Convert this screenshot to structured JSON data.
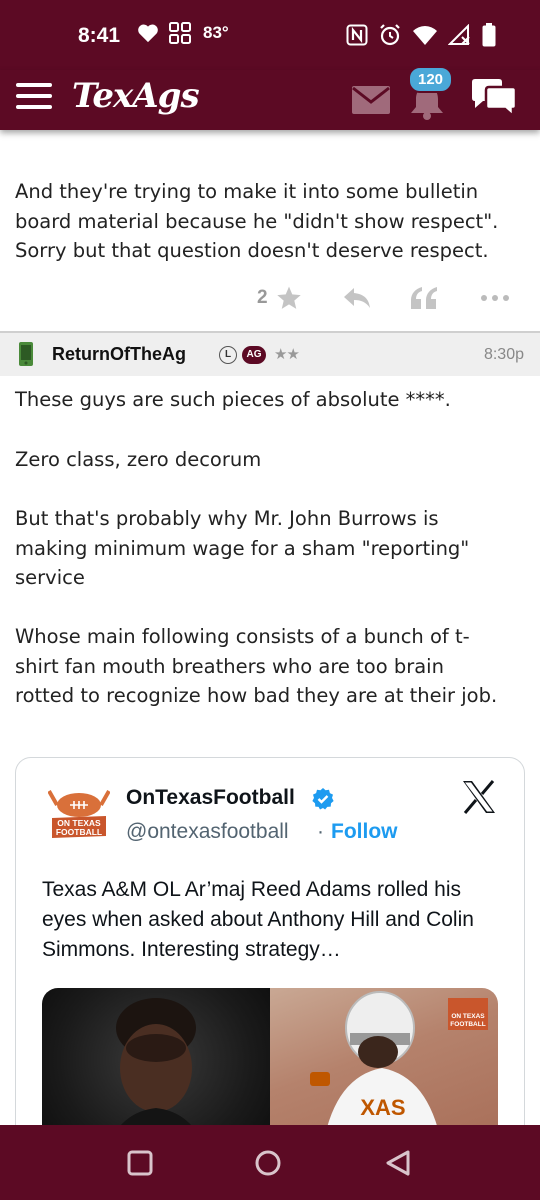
{
  "status_bar": {
    "time": "8:41",
    "temperature": "83°"
  },
  "app_bar": {
    "logo": "TexAgs",
    "notification_count": "120"
  },
  "post1": {
    "text": "And they're trying to make it into some bulletin\nboard material because he \"didn't show respect\".\nSorry but that question doesn't deserve respect.",
    "like_count": "2"
  },
  "post2": {
    "username": "ReturnOfTheAg",
    "l_badge": "L",
    "ag_badge": "AG",
    "stars": "★★",
    "time": "8:30p",
    "paragraphs": [
      "These guys are such pieces of absolute ****.",
      "Zero class, zero decorum",
      "But that's probably why Mr. John Burrows is\nmaking minimum wage for a sham \"reporting\"\nservice",
      "Whose main following consists of a bunch of t-\nshirt fan mouth breathers who are too brain\nrotted to recognize how bad they are at their job."
    ]
  },
  "tweet": {
    "name": "OnTexasFootball",
    "handle": "@ontexasfootball",
    "separator": "·",
    "follow_label": "Follow",
    "logo_text": "ON TEXAS FOOTBALL",
    "text": "Texas A&M OL Ar’maj Reed Adams rolled his eyes when asked about Anthony Hill and Colin Simmons. Interesting strategy…",
    "jersey_text": "XAS"
  },
  "colors": {
    "maroon": "#5c0a24",
    "badge_blue": "#4aa8d8",
    "twitter_blue": "#1d9bf0"
  }
}
